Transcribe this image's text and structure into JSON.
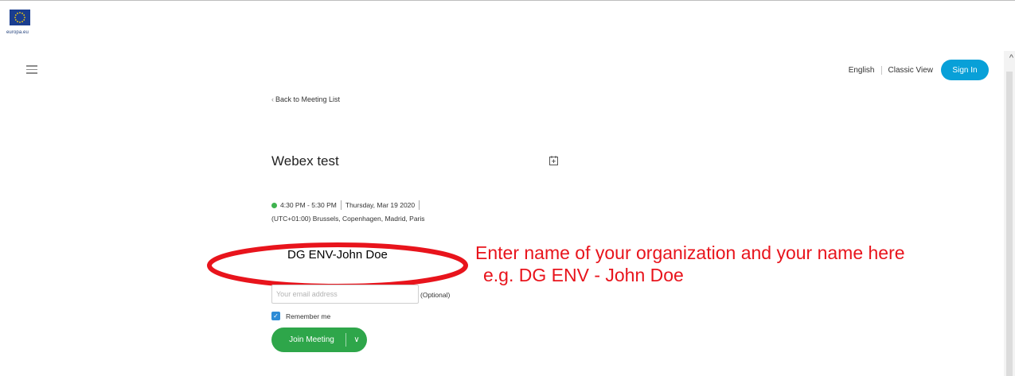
{
  "header": {
    "logo_text": "europa.eu",
    "language": "English",
    "classic_view": "Classic View",
    "sign_in": "Sign In"
  },
  "meeting": {
    "back_link": "Back to Meeting List",
    "title": "Webex test",
    "time": "4:30 PM - 5:30 PM",
    "date": "Thursday, Mar 19 2020",
    "timezone": "(UTC+01:00) Brussels, Copenhagen, Madrid, Paris"
  },
  "form": {
    "name_value": "DG ENV-John Doe",
    "email_placeholder": "Your email address",
    "optional_label": "(Optional)",
    "remember_label": "Remember me",
    "join_label": "Join Meeting"
  },
  "annotation": {
    "line1": "Enter name of your organization and your name here",
    "line2": "e.g. DG ENV - John Doe"
  },
  "colors": {
    "accent_blue": "#08a0d8",
    "join_green": "#2ea64a",
    "annotation_red": "#e8141c",
    "status_green": "#3fb34f"
  },
  "icons": [
    "eu-flag-icon",
    "hamburger-menu-icon",
    "chevron-left-icon",
    "calendar-add-icon",
    "status-dot-icon",
    "checkbox-checked-icon",
    "chevron-down-icon",
    "scroll-up-arrow-icon"
  ]
}
